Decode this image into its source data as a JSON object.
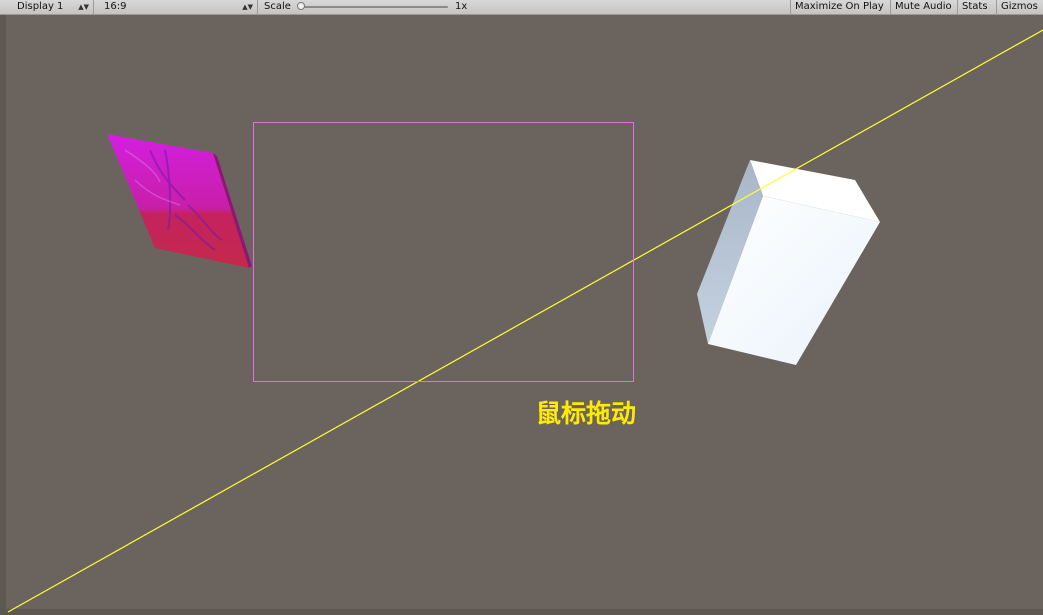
{
  "toolbar": {
    "display_select": "Display 1",
    "aspect_select": "16:9",
    "scale_label": "Scale",
    "scale_value": "1x",
    "scale_level": 0.0,
    "maximize_label": "Maximize On Play",
    "mute_label": "Mute Audio",
    "stats_label": "Stats",
    "gizmos_label": "Gizmos"
  },
  "scene": {
    "background_color": "#6b635d",
    "selection_color": "#e36fe0",
    "ray_color": "#ffff33",
    "annotation": "鼠标拖动",
    "annotation_color": "#ffea00"
  }
}
